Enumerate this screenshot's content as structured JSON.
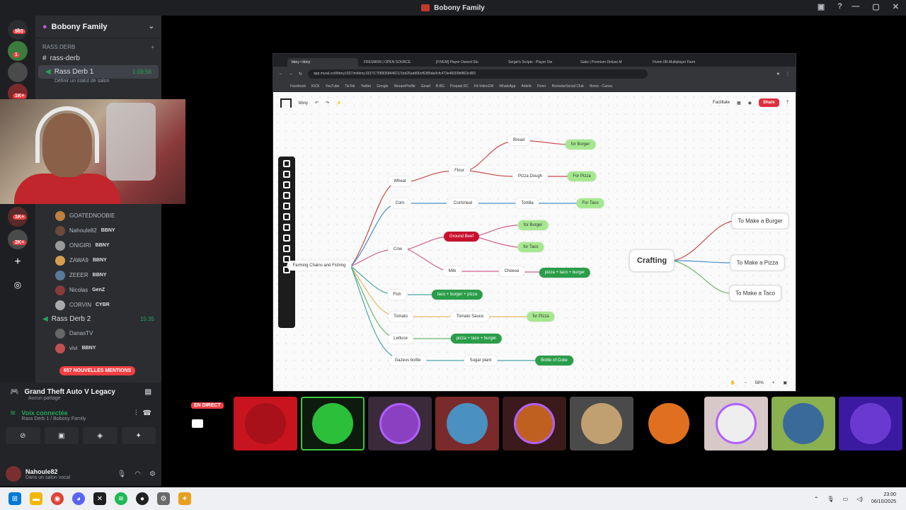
{
  "window": {
    "title": "Bobony Family"
  },
  "rail": {
    "servers": [
      {
        "icon": "discord-icon",
        "badge": "983"
      },
      {
        "icon": "avatar-icon",
        "badge": "1"
      },
      {
        "icon": "avatar-icon",
        "badge": ""
      },
      {
        "icon": "avatar-icon",
        "badge": "1K+"
      }
    ],
    "lower_badges": [
      "1K+",
      "2K+"
    ]
  },
  "server": {
    "name": "Bobony Family"
  },
  "channels": {
    "category": "RASS DERB",
    "text_channel": "rass-derb",
    "voice_channel_1": {
      "name": "Rass Derb 1",
      "time": "1:09:56",
      "status": "Définir un statut de salon"
    },
    "voice_users_1": [
      {
        "name": "GOATEDNOOBIE",
        "tag": ""
      },
      {
        "name": "Nahoule82",
        "tag": "BBNY"
      },
      {
        "name": "ONIGIRI",
        "tag": "BBNY"
      },
      {
        "name": "ZAWA9",
        "tag": "BBNY"
      },
      {
        "name": "ZEEER",
        "tag": "BBNY"
      },
      {
        "name": "Nicolas",
        "tag": "GenZ"
      },
      {
        "name": "CORVIN",
        "tag": "CYBR"
      }
    ],
    "voice_channel_2": {
      "name": "Rass Derb 2",
      "time": "15:35"
    },
    "voice_users_2": [
      {
        "name": "DanasTV",
        "tag": ""
      },
      {
        "name": "vivi",
        "tag": "BBNY"
      }
    ],
    "mentions": "657 NOUVELLES MENTIONS"
  },
  "activity": {
    "game": "Grand Theft Auto V Legacy",
    "sub": "Aucun partage"
  },
  "voice": {
    "status": "Voix connectée",
    "location": "Rass Derb 1 / Bobony Family"
  },
  "user": {
    "name": "Nahoule82",
    "status": "Dans un salon vocal"
  },
  "browser": {
    "tabs": [
      "bbny • bbny",
      "FRESMON | OPEN SOURCE",
      "[FIVEM] Player Owned Sto",
      "Sergei's Scripts - Player Ow",
      "Gabz | Premium Deluxe M",
      "Fivem 0R-Multiplayer Farm"
    ],
    "url": "app.mural.co/t/bbny1937/m/bbny1937/1758905844821/1bd26add90cf6385da4cfc473e46000bf863c983",
    "bookmarks": [
      "Facebook",
      "KICK",
      "YouTube",
      "TikTok",
      "Twitter",
      "Google",
      "StreamProfile",
      "Gmail",
      "B-BG",
      "Prepaid DC",
      "Fit-Video2W",
      "WhatsApp",
      "Airbnb",
      "Fiverr",
      "RockstarSocial Club",
      "Home - Canva"
    ]
  },
  "mural": {
    "board": "bbny",
    "facilitator": "Facilitate",
    "share": "Share",
    "zoom": "58%",
    "nodes": {
      "root": "Farming Chains and Fishing",
      "wheat": "Wheat",
      "corn": "Corn",
      "cow": "Cow",
      "fish": "Fish",
      "tomato": "Tomato",
      "lettuce": "Lettuce",
      "gazeus": "Gazeus bottle",
      "flour": "Flour",
      "bread": "Bread",
      "pizza_dough": "Pizza Dough",
      "for_burger_1": "for Burger",
      "for_pizza_1": "For Pizza",
      "cornmeal": "Cornmeal",
      "tortilla": "Tortilla",
      "for_taco_1": "For Taco",
      "ground_beef": "Ground Beef",
      "for_burger_2": "for Burger",
      "for_taco_2": "for Taco",
      "milk": "Milk",
      "cheese": "Cheese",
      "pizza_taco_burger_1": "pizza + taco + burger",
      "taco_burger_pizza": "taco + burger + pizza",
      "tomato_sauce": "Tomato Sauce",
      "for_pizza_2": "for Pizza",
      "pizza_taco_burger_2": "pizza + taco + burger",
      "sugar_plant": "Sugar plant",
      "bottle_of_coke": "Bottle of Coke",
      "crafting": "Crafting",
      "to_burger": "To Make a Burger",
      "to_pizza": "To Make a Pizza",
      "to_taco": "To Make a Taco"
    }
  },
  "stage": {
    "live_badge": "EN DIRECT"
  },
  "taskbar": {
    "time": "23:00",
    "date": "06/10/2025"
  },
  "colors": {
    "discord_red": "#f23f43",
    "discord_green": "#23a55a",
    "mural_red": "#e0303f"
  }
}
